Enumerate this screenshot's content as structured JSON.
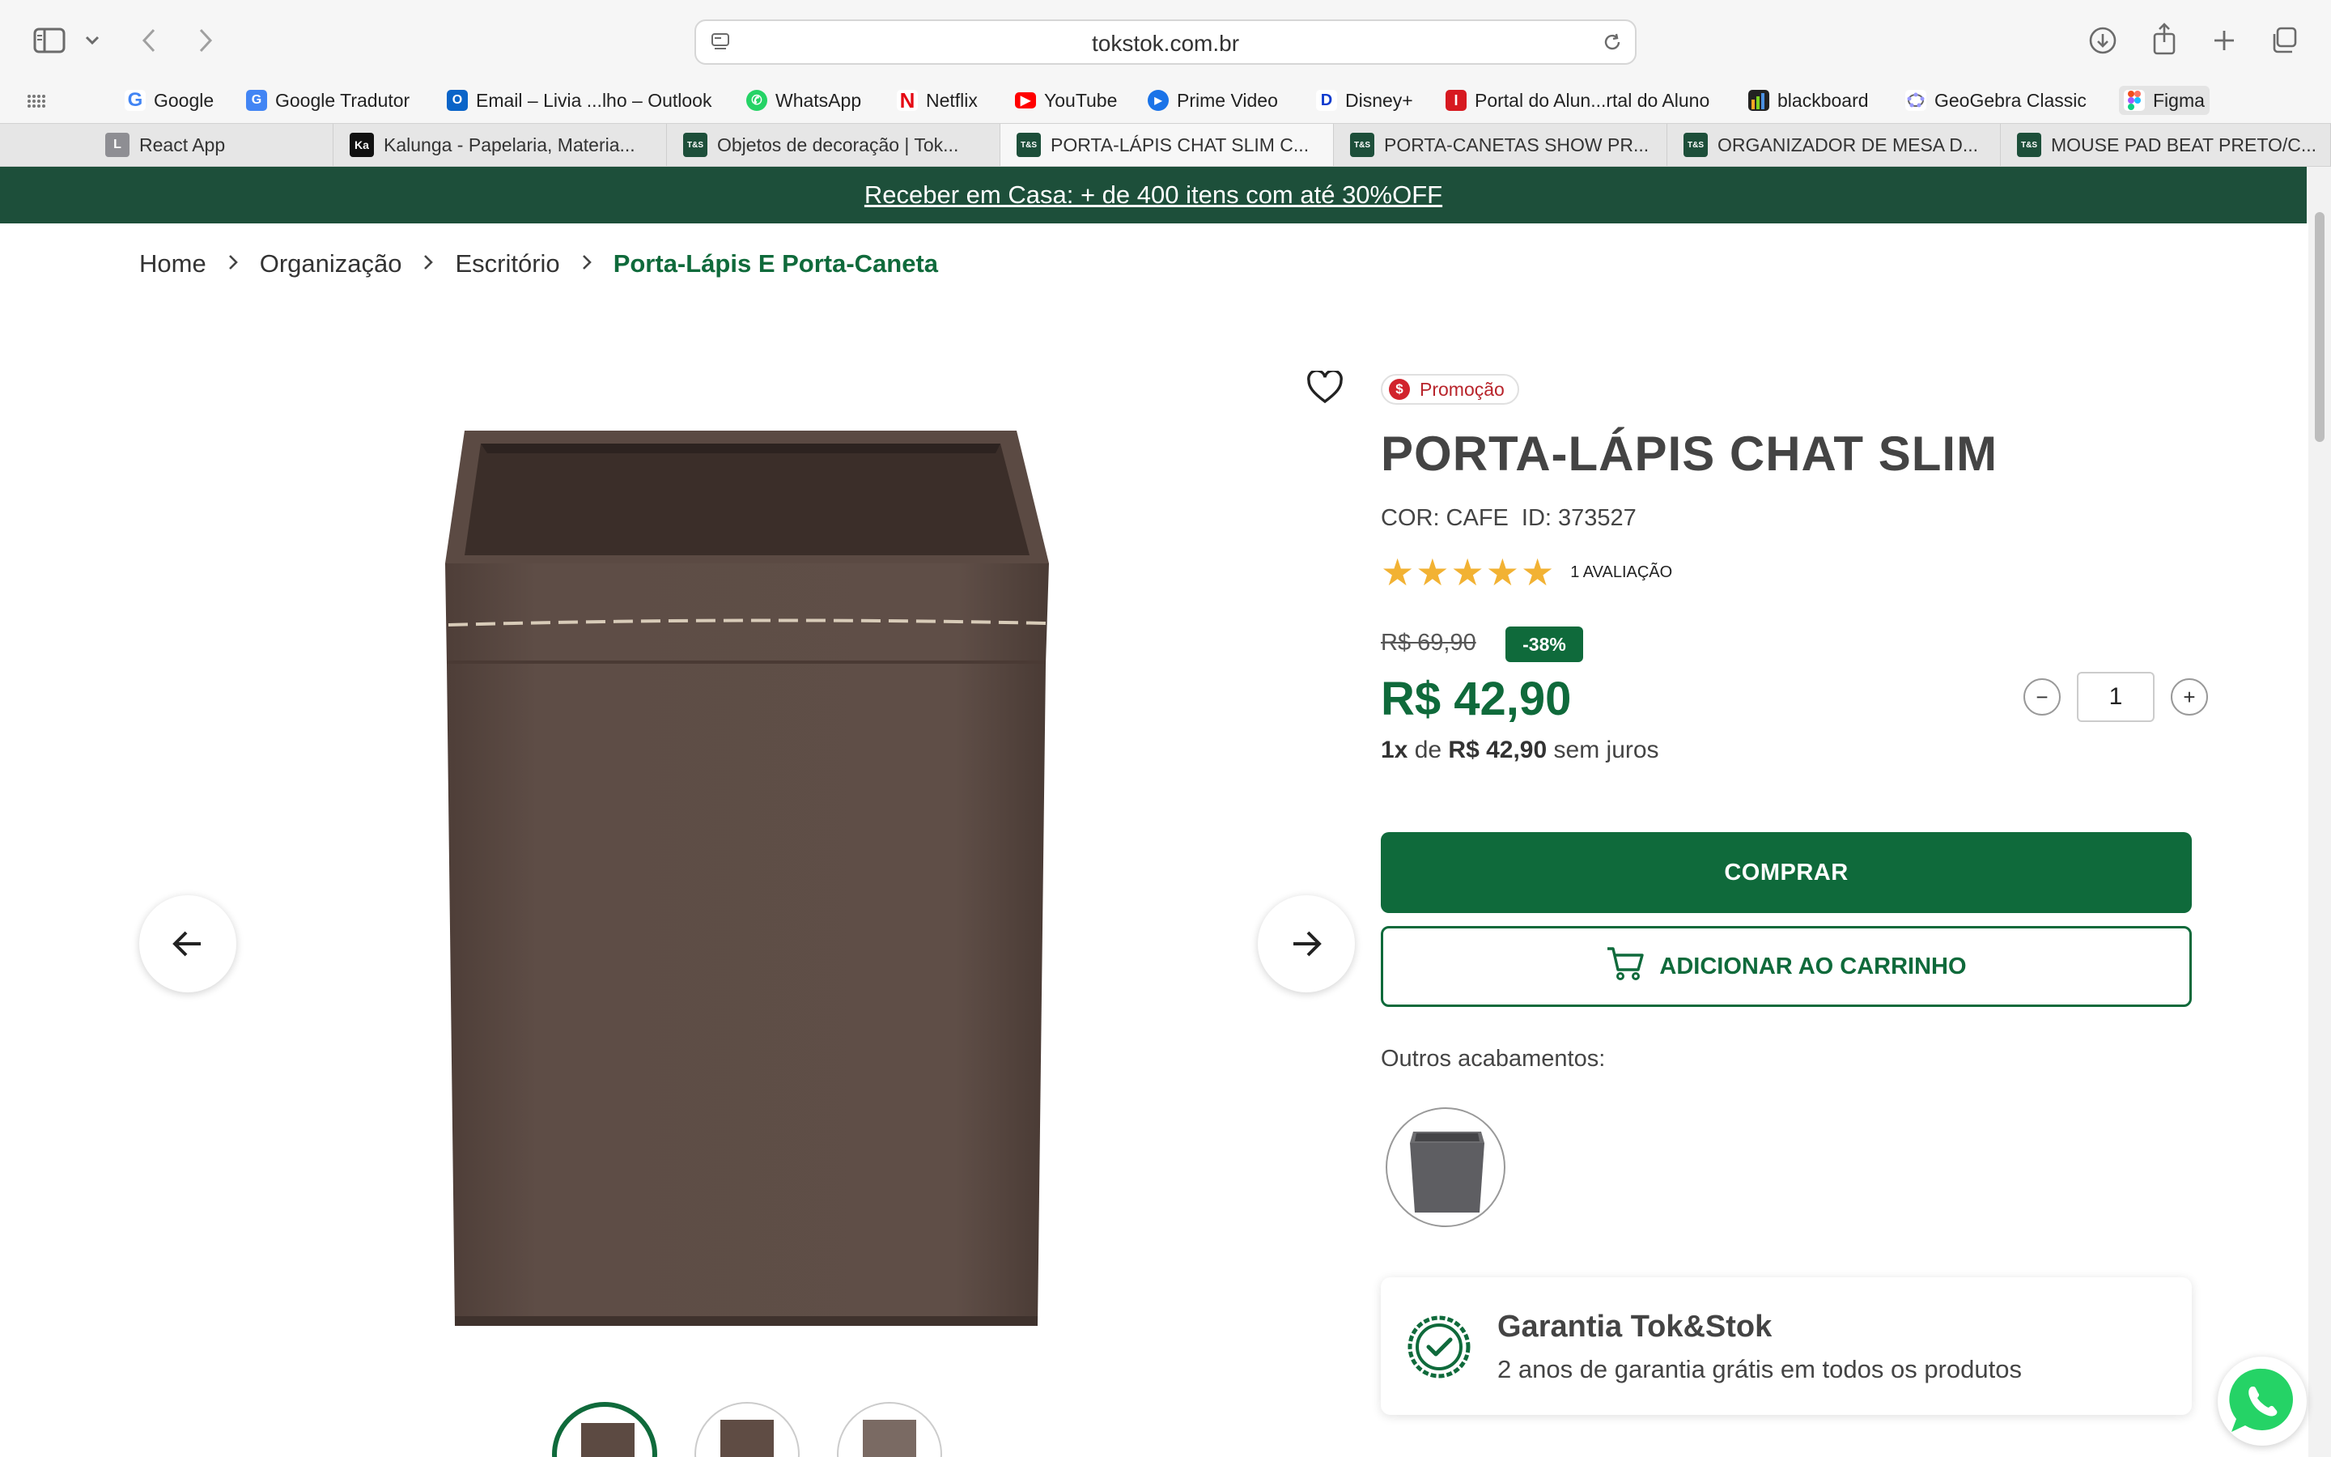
{
  "browser": {
    "url": "tokstok.com.br",
    "bookmarks": [
      {
        "label": "Google",
        "icon": "google-icon"
      },
      {
        "label": "Google Tradutor",
        "icon": "google-translate-icon"
      },
      {
        "label": "Email – Livia ...lho – Outlook",
        "icon": "outlook-icon"
      },
      {
        "label": "WhatsApp",
        "icon": "whatsapp-icon"
      },
      {
        "label": "Netflix",
        "icon": "netflix-icon"
      },
      {
        "label": "YouTube",
        "icon": "youtube-icon"
      },
      {
        "label": "Prime Video",
        "icon": "prime-video-icon"
      },
      {
        "label": "Disney+",
        "icon": "disney-plus-icon"
      },
      {
        "label": "Portal do Alun...rtal do Aluno",
        "icon": "portal-icon"
      },
      {
        "label": "blackboard",
        "icon": "blackboard-icon"
      },
      {
        "label": "GeoGebra Classic",
        "icon": "geogebra-icon"
      },
      {
        "label": "Figma",
        "icon": "figma-icon"
      }
    ],
    "tabs": [
      {
        "label": "React App",
        "active": false
      },
      {
        "label": "Kalunga - Papelaria, Materia...",
        "active": false
      },
      {
        "label": "Objetos de decoração | Tok...",
        "active": false
      },
      {
        "label": "PORTA-LÁPIS CHAT SLIM C...",
        "active": true
      },
      {
        "label": "PORTA-CANETAS SHOW PR...",
        "active": false
      },
      {
        "label": "ORGANIZADOR DE MESA D...",
        "active": false
      },
      {
        "label": "MOUSE PAD BEAT PRETO/C...",
        "active": false
      }
    ]
  },
  "page": {
    "promo_bar": "Receber em Casa: + de 400 itens com até 30%OFF",
    "breadcrumb": [
      "Home",
      "Organização",
      "Escritório",
      "Porta-Lápis E Porta-Caneta"
    ],
    "product": {
      "badge": "Promoção",
      "title": "PORTA-LÁPIS CHAT SLIM",
      "color": "COR: CAFE",
      "id": "ID: 373527",
      "stars": "★★★★★",
      "rating_value": 5,
      "rating_count": "1 AVALIAÇÃO",
      "old_price": "R$ 69,90",
      "discount": "-38%",
      "price": "R$ 42,90",
      "installment_prefix": "1x",
      "installment_middle": " de ",
      "installment_amount": "R$ 42,90",
      "installment_suffix": " sem juros",
      "quantity": "1",
      "qty_minus": "−",
      "qty_plus": "+",
      "buy_label": "COMPRAR",
      "cart_label": "ADICIONAR AO CARRINHO",
      "other_finishes_label": "Outros acabamentos:"
    },
    "warranty": {
      "title": "Garantia Tok&Stok",
      "subtitle": "2 anos de garantia grátis em todos os produtos"
    }
  },
  "colors": {
    "brand_green": "#0f6a3b",
    "promo_bar_bg": "#1d4f3a",
    "promo_red": "#d1232c",
    "star": "#f2b233",
    "product_brown": "#5c4a42"
  }
}
